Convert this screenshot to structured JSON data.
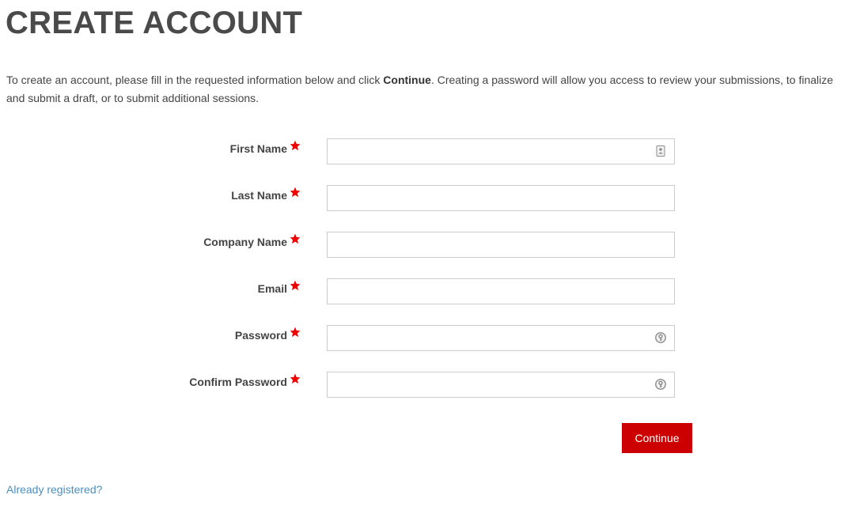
{
  "page": {
    "title": "CREATE ACCOUNT",
    "intro_before": "To create an account, please fill in the requested information below and click ",
    "intro_bold": "Continue",
    "intro_after": ". Creating a password will allow you access to review your submissions, to finalize and submit a draft, or to submit additional sessions."
  },
  "colors": {
    "required_star": "#ee0000",
    "button_bg": "#cc0000",
    "link": "#4a8fc0"
  },
  "form": {
    "fields": [
      {
        "label": "First Name",
        "value": "",
        "required": true,
        "icon": "contact-card-icon"
      },
      {
        "label": "Last Name",
        "value": "",
        "required": true,
        "icon": ""
      },
      {
        "label": "Company Name",
        "value": "",
        "required": true,
        "icon": ""
      },
      {
        "label": "Email",
        "value": "",
        "required": true,
        "icon": ""
      },
      {
        "label": "Password",
        "value": "",
        "required": true,
        "icon": "password-key-icon"
      },
      {
        "label": "Confirm Password",
        "value": "",
        "required": true,
        "icon": "password-key-icon"
      }
    ],
    "submit_label": "Continue"
  },
  "footer": {
    "login_link": "Already registered?"
  }
}
